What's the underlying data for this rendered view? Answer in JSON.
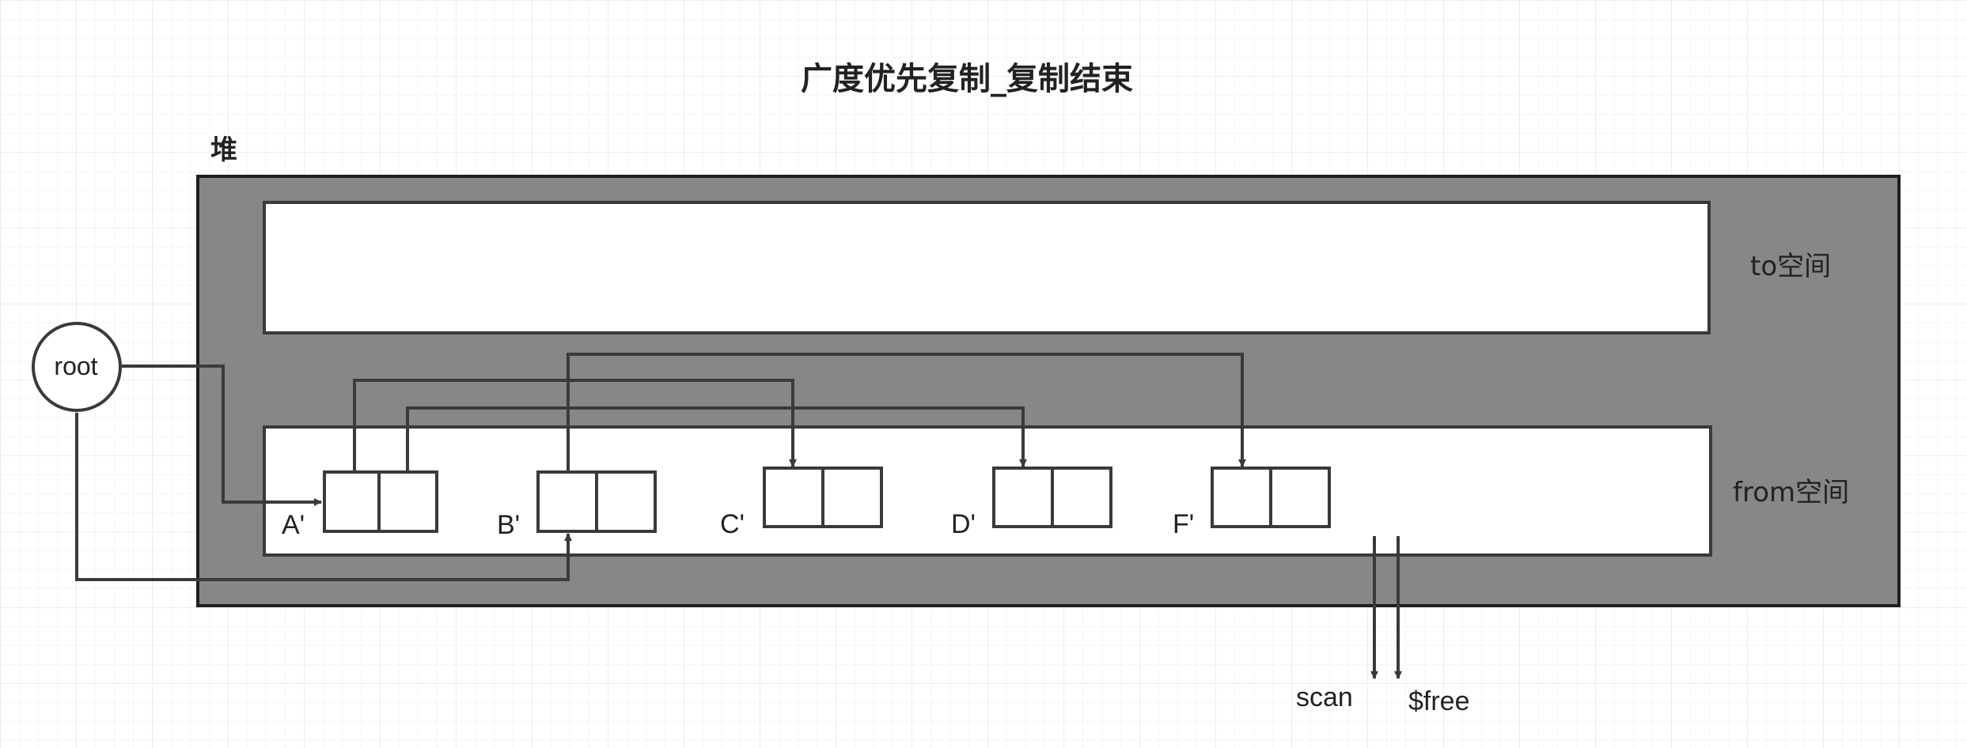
{
  "title": "广度优先复制_复制结束",
  "heap": {
    "label": "堆",
    "fill_color": "#878787"
  },
  "to_space": {
    "label": "to空间"
  },
  "from_space": {
    "label": "from空间"
  },
  "root": {
    "label": "root"
  },
  "objects": [
    {
      "id": "A",
      "label": "A'"
    },
    {
      "id": "B",
      "label": "B'"
    },
    {
      "id": "C",
      "label": "C'"
    },
    {
      "id": "D",
      "label": "D'"
    },
    {
      "id": "F",
      "label": "F'"
    }
  ],
  "pointers": {
    "scan": "scan",
    "free": "$free"
  },
  "edges": [
    {
      "from": "root",
      "to": "A"
    },
    {
      "from": "root",
      "to": "B"
    },
    {
      "from": "A",
      "to": "C"
    },
    {
      "from": "A",
      "to": "D"
    },
    {
      "from": "B",
      "to": "F"
    }
  ]
}
